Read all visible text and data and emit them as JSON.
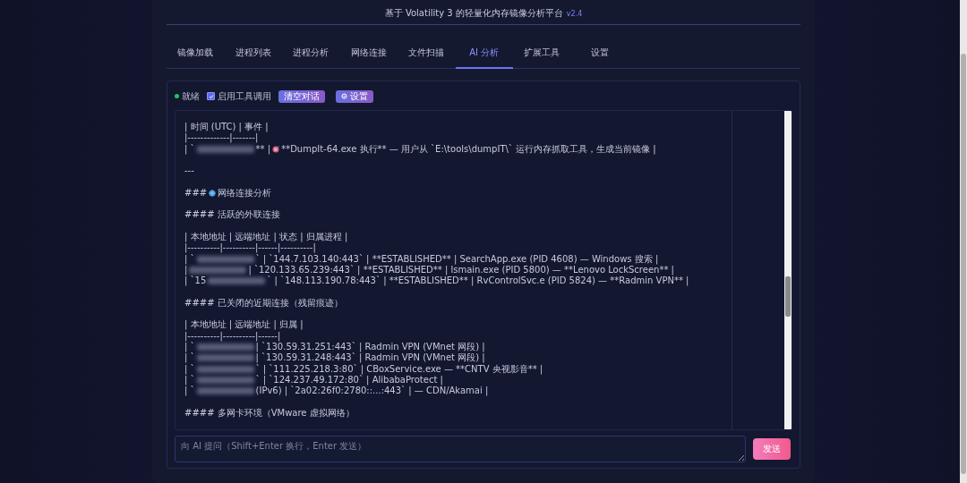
{
  "header": {
    "title": "基于 Volatility 3 的轻量化内存镜像分析平台",
    "version": "v2.4"
  },
  "tabs": [
    {
      "label": "镜像加载",
      "selected": false
    },
    {
      "label": "进程列表",
      "selected": false
    },
    {
      "label": "进程分析",
      "selected": false
    },
    {
      "label": "网络连接",
      "selected": false
    },
    {
      "label": "文件扫描",
      "selected": false
    },
    {
      "label": "AI 分析",
      "selected": true
    },
    {
      "label": "扩展工具",
      "selected": false
    },
    {
      "label": "设置",
      "selected": false
    }
  ],
  "toolbar": {
    "status": {
      "label": "就绪",
      "color": "#22c55e"
    },
    "tool_toggle": {
      "label": "启用工具调用",
      "checked": true
    },
    "clear_button": "清空对话",
    "settings_button": "设置"
  },
  "messages": [
    {
      "kind": "text",
      "text": "| 时间 (UTC) | 事件 |"
    },
    {
      "kind": "text",
      "text": "|-------------|-------|"
    },
    {
      "kind": "event",
      "lead": "| `",
      "after": "** |",
      "text": "**DumpIt-64.exe 执行** — 用户从 `E:\\tools\\dumpIT\\` 运行内存抓取工具，生成当前镜像 |"
    },
    {
      "kind": "blank"
    },
    {
      "kind": "text",
      "text": "---"
    },
    {
      "kind": "blank"
    },
    {
      "kind": "heading",
      "lead": "###",
      "text": "网络连接分析"
    },
    {
      "kind": "blank"
    },
    {
      "kind": "text",
      "text": "#### 活跃的外联连接"
    },
    {
      "kind": "blank"
    },
    {
      "kind": "text",
      "text": "| 本地地址 | 远端地址 | 状态 | 归属进程 |"
    },
    {
      "kind": "text",
      "text": "|----------|----------|------|----------|"
    },
    {
      "kind": "redacted",
      "lead": "| `",
      "after": "` | `144.7.103.140:443` | **ESTABLISHED** | SearchApp.exe (PID 4608) — Windows 搜索 |"
    },
    {
      "kind": "redacted",
      "lead": "|",
      "after": "| `120.133.65.239:443` | **ESTABLISHED** | lsmain.exe (PID 5800) — **Lenovo LockScreen** |"
    },
    {
      "kind": "redacted",
      "lead": "| `15",
      "after": "` | `148.113.190.78:443` | **ESTABLISHED** | RvControlSvc.e (PID 5824) — **Radmin VPN** |"
    },
    {
      "kind": "blank"
    },
    {
      "kind": "text",
      "text": "#### 已关闭的近期连接（残留痕迹）"
    },
    {
      "kind": "blank"
    },
    {
      "kind": "text",
      "text": "| 本地地址 | 远端地址 | 归属 |"
    },
    {
      "kind": "text",
      "text": "|----------|----------|------|"
    },
    {
      "kind": "redacted",
      "lead": "| `",
      "after": "| `130.59.31.251:443` | Radmin VPN (VMnet 网段) |"
    },
    {
      "kind": "redacted",
      "lead": "| `",
      "after": "| `130.59.31.248:443` | Radmin VPN (VMnet 网段) |"
    },
    {
      "kind": "redacted",
      "lead": "| `",
      "after": "` | `111.225.218.3:80` | CBoxService.exe — **CNTV 央视影音** |"
    },
    {
      "kind": "redacted",
      "lead": "| `",
      "after": "` | `124.237.49.172:80` | AlibabaProtect |"
    },
    {
      "kind": "redacted",
      "lead": "| `",
      "after": "(IPv6) | `2a02:26f0:2780::...:443` | — CDN/Akamai |"
    },
    {
      "kind": "blank"
    },
    {
      "kind": "text",
      "text": "#### 多网卡环境（VMware 虚拟网络）"
    }
  ],
  "composer": {
    "placeholder": "向 AI 提问（Shift+Enter 换行，Enter 发送）",
    "send_button": "发送"
  }
}
